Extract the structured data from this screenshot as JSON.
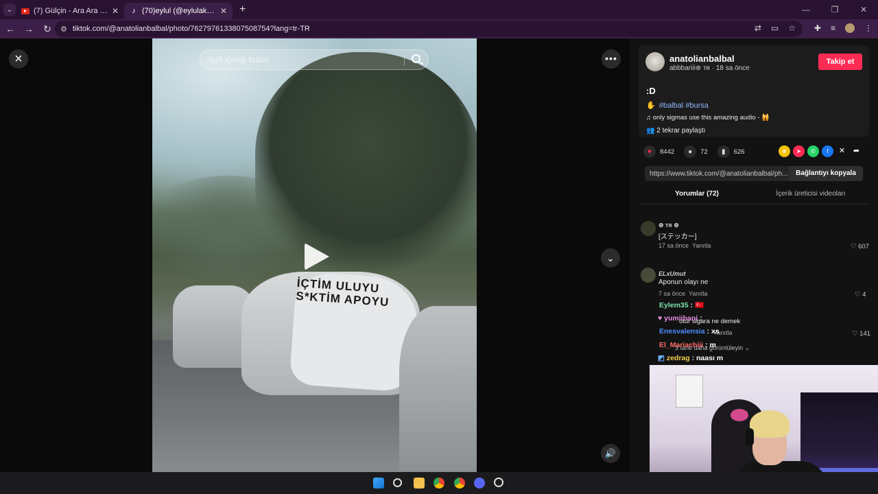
{
  "browser": {
    "tabs": [
      {
        "label": "(7) Gülçin - Ara Ara (Official Vid",
        "favicon": "youtube-icon",
        "active": false
      },
      {
        "label": "(70)eylul (@eylulakbyik) | TikTo",
        "favicon": "tiktok-icon",
        "active": true
      }
    ],
    "url": "tiktok.com/@anatolianbalbal/photo/7627976133807508754?lang=tr-TR"
  },
  "viewer": {
    "search_placeholder": "İlgili içeriği bulun",
    "banner_text": "İÇTİM ULUYU S*KTİM APOYU"
  },
  "post": {
    "author": "anatolianbalbal",
    "author_sub": "abbbariii⊕ ᴛʀ · 18 sa önce",
    "follow_label": "Takip et",
    "description": ":D",
    "tags": "#balbal #bursa",
    "music": "only sigmas use this amazing audio - 🙀",
    "repost": "2 tekrar paylaştı",
    "likes": "8442",
    "comments": "72",
    "saves": "626",
    "link": "https://www.tiktok.com/@anatolianbalbal/ph...",
    "copy_label": "Bağlantıyı kopyala"
  },
  "comment_tabs": [
    "Yorumlar (72)",
    "İçerik üreticisi videoları"
  ],
  "comments": [
    {
      "name": "⊕ ᴛʀ ⊕",
      "text": "[ステッカー]",
      "time": "17 sa önce",
      "reply": "Yanıtla",
      "likes": "607"
    },
    {
      "name": "ELxUmut",
      "text": "Aponun olayı ne",
      "time": "7 sa önce",
      "reply": "Yanıtla",
      "likes": "4"
    },
    {
      "name": "",
      "text": "otur sigara ne demek",
      "time": "",
      "reply": "Yanıtla",
      "likes": "141"
    }
  ],
  "more_replies": "3 tane daha görüntüleyin",
  "chat": [
    {
      "user": "Eylem35",
      "msg": ": 🇹🇷",
      "color": "#7ee2a8"
    },
    {
      "user": "yumiibani",
      "msg": ":",
      "color": "#e58fe3"
    },
    {
      "user": "Enesvalensia",
      "msg": ": xs",
      "color": "#4d8dff"
    },
    {
      "user": "El_Mariachiii",
      "msg": ": m",
      "color": "#ff6b6b"
    },
    {
      "user": "zedrag",
      "msg": ": naası m",
      "color": "#f5d04a"
    }
  ],
  "colors": {
    "accent": "#fe2c55",
    "tab_bg": "#3c1f48"
  }
}
